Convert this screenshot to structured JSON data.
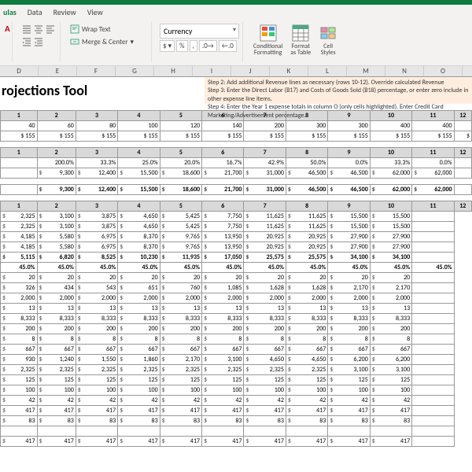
{
  "menu": {
    "items": [
      "ulas",
      "Data",
      "Review",
      "View"
    ]
  },
  "ribbon": {
    "wrap": "Wrap Text",
    "merge": "Merge & Center",
    "numfmt": "Currency",
    "cond": "Conditional\nFormatting",
    "fmttable": "Format\nas Table",
    "cellstyles": "Cell\nStyles"
  },
  "colheaders": [
    "D",
    "E",
    "F",
    "G",
    "H",
    "I",
    "J",
    "K",
    "L",
    "M",
    "N",
    "O"
  ],
  "title": "rojections Tool",
  "instructions": {
    "s2": "Step 2: Add additional Revenue lines as necessary (rows 10-12). Override calculated Revenue",
    "s3": "Step 3: Enter the Direct Labor (B17) and Costs of Goods Sold (B18) percentage, or enter zero include in other expense line items.",
    "s4": "Step 4: Enter the Year 1 expense totals in column O (only cells highlighted). Enter Credit Card Marketing/Advertisement percentage."
  },
  "months": [
    "1",
    "2",
    "3",
    "4",
    "5",
    "6",
    "7",
    "8",
    "9",
    "10",
    "11",
    "12"
  ],
  "block1": {
    "r1": [
      "40",
      "60",
      "80",
      "100",
      "120",
      "140",
      "200",
      "300",
      "300",
      "400",
      "400",
      ""
    ],
    "r2": [
      "$ 155",
      "$ 155",
      "$ 155",
      "$ 155",
      "$ 155",
      "$ 155",
      "$ 155",
      "$ 155",
      "$ 155",
      "$ 155",
      "$ 155",
      "$"
    ]
  },
  "block2": {
    "pct": [
      "",
      "200.0%",
      "33.3%",
      "25.0%",
      "20.0%",
      "16.7%",
      "42.9%",
      "50.0%",
      "0.0%",
      "33.3%",
      "0.0%",
      ""
    ],
    "rev": [
      "",
      "9,300",
      "12,400",
      "15,500",
      "18,600",
      "21,700",
      "31,000",
      "46,500",
      "46,500",
      "62,000",
      "62,000",
      ""
    ],
    "tot": [
      "",
      "9,300",
      "12,400",
      "15,500",
      "18,600",
      "21,700",
      "31,000",
      "46,500",
      "46,500",
      "62,000",
      "62,000",
      ""
    ]
  },
  "block3": {
    "rows": [
      [
        "2,325",
        "3,100",
        "3,875",
        "4,650",
        "5,425",
        "7,750",
        "11,625",
        "11,625",
        "15,500",
        "15,500",
        ""
      ],
      [
        "2,325",
        "3,100",
        "3,875",
        "4,650",
        "5,425",
        "7,750",
        "11,625",
        "11,625",
        "15,500",
        "15,500",
        ""
      ],
      [
        "4,185",
        "5,580",
        "6,975",
        "8,370",
        "9,765",
        "13,950",
        "20,925",
        "20,925",
        "27,900",
        "27,900",
        ""
      ],
      [
        "4,185",
        "5,580",
        "6,975",
        "8,370",
        "9,765",
        "13,950",
        "20,925",
        "20,925",
        "27,900",
        "27,900",
        ""
      ],
      [
        "5,115",
        "6,820",
        "8,525",
        "10,230",
        "11,935",
        "17,050",
        "25,575",
        "25,575",
        "34,100",
        "34,100",
        ""
      ],
      [
        "45.0%",
        "45.0%",
        "45.0%",
        "45.0%",
        "45.0%",
        "45.0%",
        "45.0%",
        "45.0%",
        "45.0%",
        "45.0%",
        "45.0%"
      ],
      [
        "20",
        "20",
        "20",
        "20",
        "20",
        "20",
        "20",
        "20",
        "20",
        "20",
        ""
      ],
      [
        "326",
        "434",
        "543",
        "651",
        "760",
        "1,085",
        "1,628",
        "1,628",
        "2,170",
        "2,170",
        ""
      ],
      [
        "2,000",
        "2,000",
        "2,000",
        "2,000",
        "2,000",
        "2,000",
        "2,000",
        "2,000",
        "2,000",
        "2,000",
        ""
      ],
      [
        "13",
        "13",
        "13",
        "13",
        "13",
        "13",
        "13",
        "13",
        "13",
        "13",
        ""
      ],
      [
        "8,333",
        "8,333",
        "8,333",
        "8,333",
        "8,333",
        "8,333",
        "8,333",
        "8,333",
        "8,333",
        "8,333",
        ""
      ],
      [
        "200",
        "200",
        "200",
        "200",
        "200",
        "200",
        "200",
        "200",
        "200",
        "200",
        ""
      ],
      [
        "8",
        "8",
        "8",
        "8",
        "8",
        "8",
        "8",
        "8",
        "8",
        "8",
        ""
      ],
      [
        "667",
        "667",
        "667",
        "667",
        "667",
        "667",
        "667",
        "667",
        "667",
        "667",
        ""
      ],
      [
        "930",
        "1,240",
        "1,550",
        "1,860",
        "2,170",
        "3,100",
        "4,650",
        "4,650",
        "6,200",
        "6,200",
        ""
      ],
      [
        "2,325",
        "2,325",
        "2,325",
        "2,325",
        "2,325",
        "2,325",
        "2,325",
        "2,325",
        "3,100",
        "3,100",
        ""
      ],
      [
        "125",
        "125",
        "125",
        "125",
        "125",
        "125",
        "125",
        "125",
        "125",
        "125",
        ""
      ],
      [
        "100",
        "100",
        "100",
        "100",
        "100",
        "100",
        "100",
        "100",
        "100",
        "100",
        ""
      ],
      [
        "42",
        "42",
        "42",
        "42",
        "42",
        "42",
        "42",
        "42",
        "42",
        "42",
        ""
      ],
      [
        "417",
        "417",
        "417",
        "417",
        "417",
        "417",
        "417",
        "417",
        "417",
        "417",
        ""
      ],
      [
        "83",
        "83",
        "83",
        "83",
        "83",
        "83",
        "83",
        "83",
        "83",
        "83",
        ""
      ],
      [
        "",
        "",
        "",
        "",
        "",
        "",
        "",
        "",
        "",
        "",
        ""
      ],
      [
        "417",
        "417",
        "417",
        "417",
        "417",
        "417",
        "417",
        "417",
        "417",
        "417",
        ""
      ]
    ]
  }
}
